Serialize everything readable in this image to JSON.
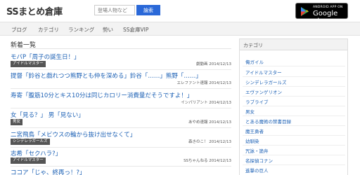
{
  "header": {
    "logo": "SSまとめ倉庫",
    "search_placeholder": "登場人物など",
    "search_button": "論索",
    "gplay_line1": "ANDROID APP ON",
    "gplay_line2": "Google play"
  },
  "nav": {
    "items": [
      "ブログ",
      "カテゴリ",
      "ランキング",
      "勢い",
      "SS倉庫VIP"
    ]
  },
  "main": {
    "section_title": "新着一覧",
    "articles": [
      {
        "title": "モバP「周子の誕生日！」",
        "tag": "アイドルマスター",
        "meta": "劇動画 2014/12/13"
      },
      {
        "title": "提督「鈴谷と戯れつつ熊野とも仲を深める」鈴谷「……」熊野「……」",
        "tag": "",
        "meta": "エレファント速報 2014/12/13"
      },
      {
        "title": "寿寄「腹筋10分とキス10分は同じカロリー消費量だそうですよ！」",
        "tag": "",
        "meta": "インパリアント 2014/12/13"
      },
      {
        "title": "女「見る？」 男「見ない」",
        "tag": "男女",
        "meta": "あやめ速報 2014/12/13"
      },
      {
        "title": "二宮飛鳥「メビウスの輪から抜け出せなくて」",
        "tag": "シンデレラガールズ",
        "meta": "森きのこ！ 2014/12/13"
      },
      {
        "title": "志希「セクハラ?」",
        "tag": "アイドルマスター",
        "meta": "SSちゃんねる 2014/12/13"
      },
      {
        "title": "ココア「じゃ、終再っ！?」",
        "tag": "",
        "meta": ""
      }
    ]
  },
  "sidebar": {
    "heading": "カテゴリ",
    "items": [
      "俺ガイル",
      "アイドルマスター",
      "シンデレラガールズ",
      "エヴァンゲリオン",
      "ラブライブ",
      "男女",
      "とある魔術の禁書目録",
      "魔王勇者",
      "幼馴染",
      "咒詠・詭弁",
      "名探偵コナン",
      "進撃の巨人"
    ]
  },
  "colors": {
    "link": "#1a5fb4",
    "search_button": "#2a68d8",
    "tag_bg": "#555555"
  }
}
